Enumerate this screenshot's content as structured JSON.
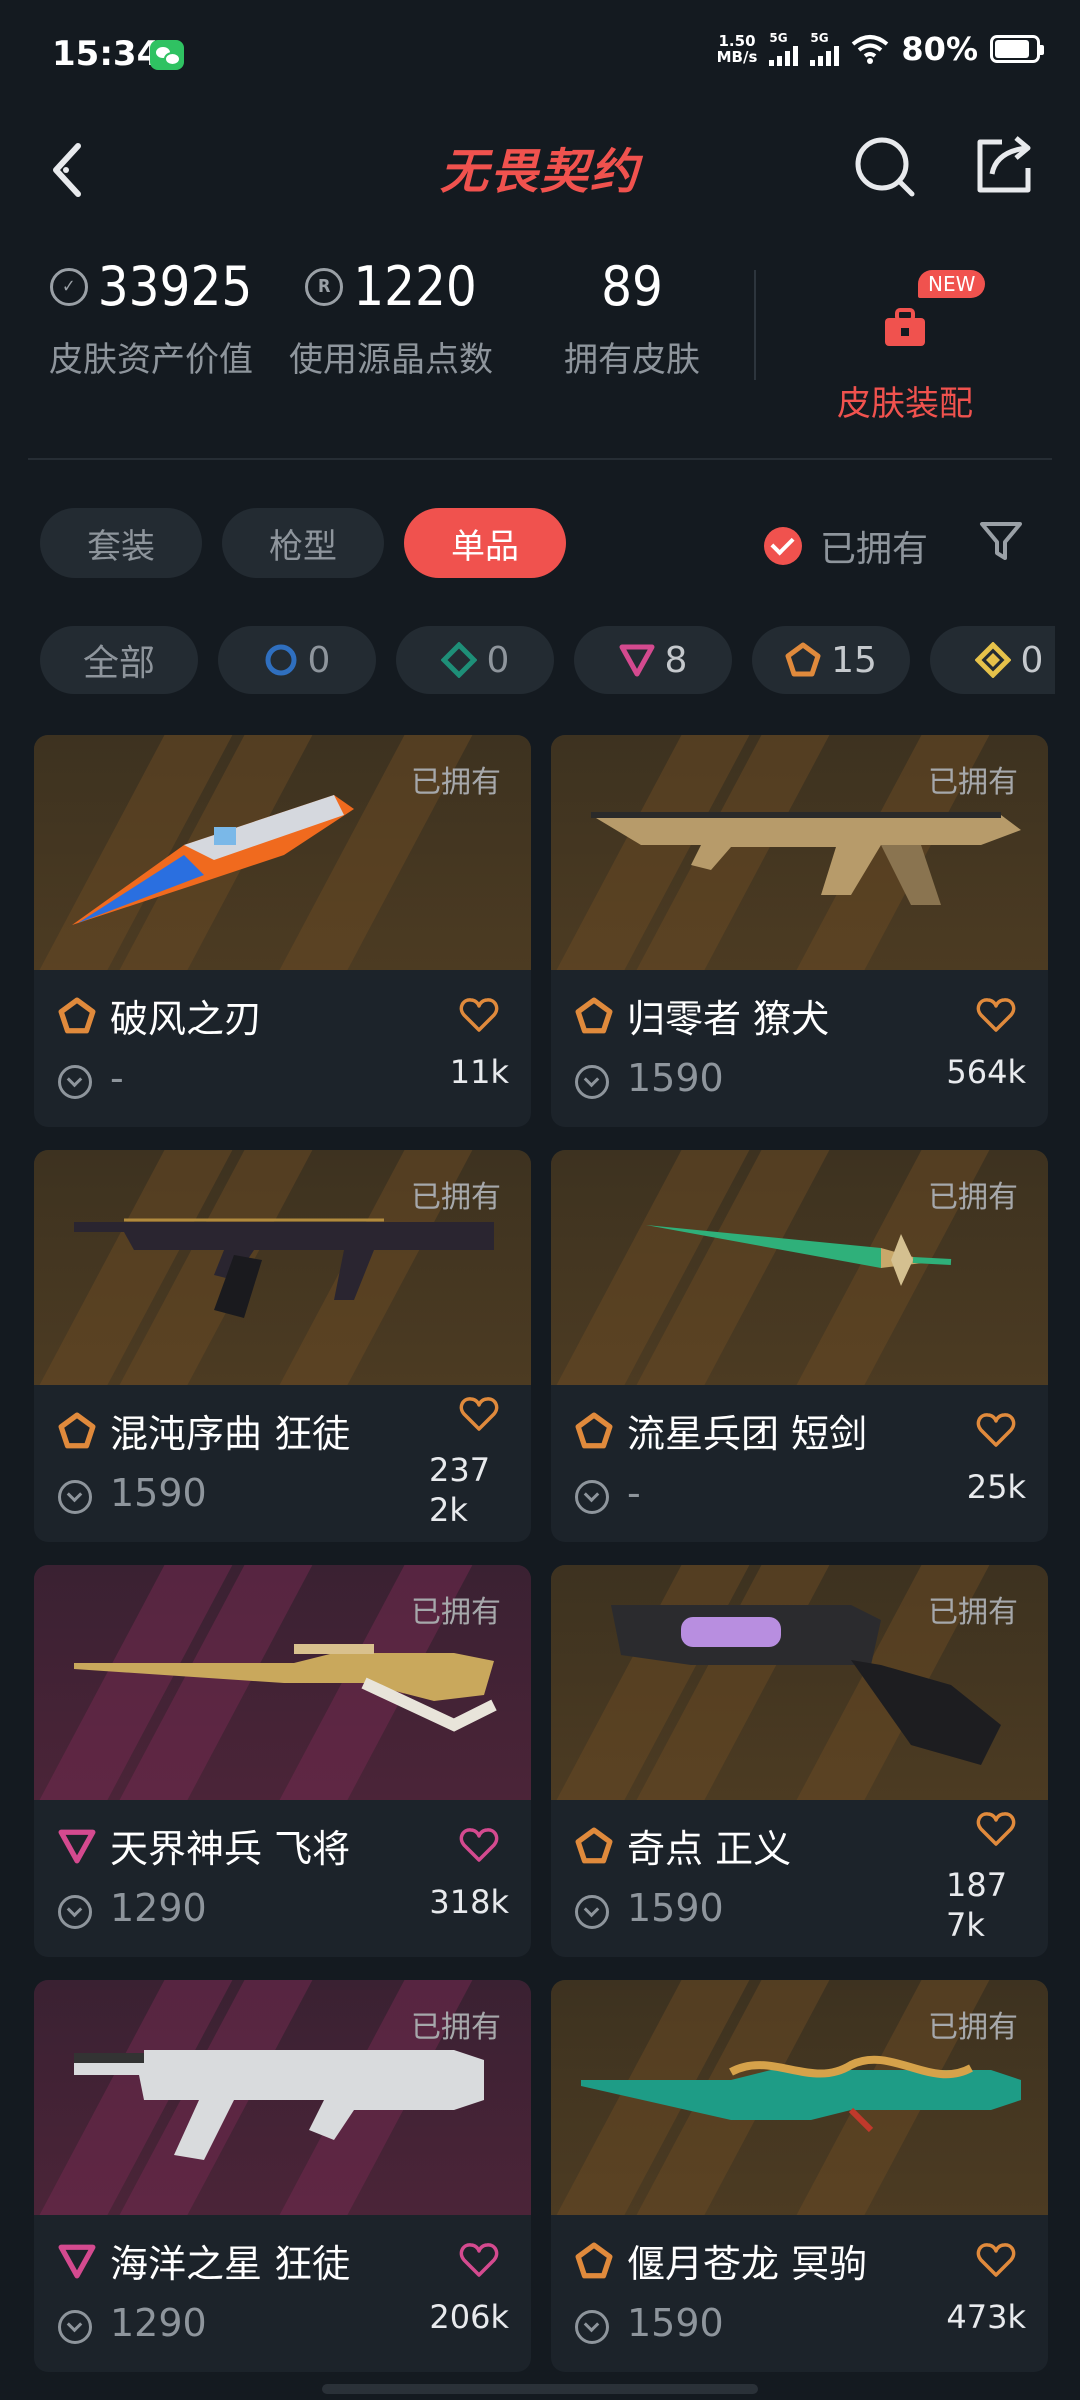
{
  "status": {
    "time": "15:34",
    "net_speed_top": "1.50",
    "net_speed_bottom": "MB/s",
    "sig1": "5G",
    "sig2": "5G",
    "battery": "80%"
  },
  "header": {
    "title": "无畏契约"
  },
  "stats": {
    "asset_value": "33925",
    "asset_label": "皮肤资产价值",
    "radianite": "1220",
    "radianite_label": "使用源晶点数",
    "skins": "89",
    "skins_label": "拥有皮肤",
    "new_badge": "NEW",
    "loadout_label": "皮肤装配"
  },
  "tabs": [
    "套装",
    "枪型",
    "单品"
  ],
  "owned_filter": "已拥有",
  "tiers": [
    {
      "label": "全部"
    },
    {
      "count": "0",
      "icon": "select-tier-icon",
      "color": "#2f6fbf"
    },
    {
      "count": "0",
      "icon": "deluxe-tier-icon",
      "color": "#1e8f78"
    },
    {
      "count": "8",
      "icon": "premium-tier-icon",
      "color": "#d44a8f"
    },
    {
      "count": "15",
      "icon": "exclusive-tier-icon",
      "color": "#e08a3c"
    },
    {
      "count": "0",
      "icon": "ultra-tier-icon",
      "color": "#e6c24a"
    }
  ],
  "cards": [
    {
      "owned": "已拥有",
      "name": "破风之刃",
      "price": "-",
      "likes": "11k",
      "tier": "exclusive",
      "bg": "gold",
      "weapon": "knife"
    },
    {
      "owned": "已拥有",
      "name": "归零者 獠犬",
      "price": "1590",
      "likes": "564k",
      "tier": "exclusive",
      "bg": "gold",
      "weapon": "rifle-gold"
    },
    {
      "owned": "已拥有",
      "name": "混沌序曲 狂徒",
      "price": "1590",
      "likes": "2372k",
      "tier": "exclusive",
      "bg": "gold",
      "weapon": "rifle-dark"
    },
    {
      "owned": "已拥有",
      "name": "流星兵团 短剑",
      "price": "-",
      "likes": "25k",
      "tier": "exclusive",
      "bg": "gold",
      "weapon": "dagger"
    },
    {
      "owned": "已拥有",
      "name": "天界神兵 飞将",
      "price": "1290",
      "likes": "318k",
      "tier": "premium",
      "bg": "purple",
      "weapon": "sniper-gold"
    },
    {
      "owned": "已拥有",
      "name": "奇点 正义",
      "price": "1590",
      "likes": "1877k",
      "tier": "exclusive",
      "bg": "gold",
      "weapon": "revolver"
    },
    {
      "owned": "已拥有",
      "name": "海洋之星 狂徒",
      "price": "1290",
      "likes": "206k",
      "tier": "premium",
      "bg": "purple",
      "weapon": "rifle-white"
    },
    {
      "owned": "已拥有",
      "name": "偃月苍龙 冥驹",
      "price": "1590",
      "likes": "473k",
      "tier": "exclusive",
      "bg": "gold",
      "weapon": "sniper-jade"
    }
  ],
  "colors": {
    "accent": "#f0524e",
    "exclusive": "#e08a3c",
    "premium": "#d44a8f"
  }
}
